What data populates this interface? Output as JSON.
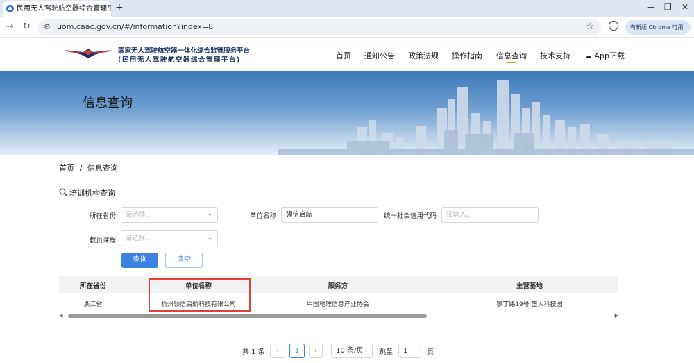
{
  "browser": {
    "tab_title": "民用无人驾驶航空器综合管理平",
    "tab_close": "✕",
    "new_tab": "+",
    "url": "uom.caac.gov.cn/#/information?index=8",
    "update_label": "有新版 Chrome 可用"
  },
  "header": {
    "brand_line1": "国家无人驾驶航空器一体化综合监管服务平台",
    "brand_line2": "(民用无人驾驶航空器综合管理平台)",
    "menu": [
      "首页",
      "通知公告",
      "政策法规",
      "操作指南",
      "信息查询",
      "技术支持",
      "App下载"
    ],
    "active_menu": "信息查询"
  },
  "banner": {
    "title": "信息查询"
  },
  "breadcrumb": {
    "home": "首页",
    "sep": "/",
    "current": "信息查询"
  },
  "section": {
    "title": "培训机构查询"
  },
  "form": {
    "province_label": "所在省份",
    "province_placeholder": "请选择..",
    "unit_label": "单位名称",
    "unit_value": "领信启航",
    "credit_label": "统一社会信用代码",
    "credit_placeholder": "请输入..",
    "course_label": "教员课程",
    "course_placeholder": "请选择..",
    "query_button": "查询",
    "clear_button": "清空"
  },
  "table": {
    "columns": [
      "所在省份",
      "单位名称",
      "服务方",
      "主营基地"
    ],
    "rows": [
      [
        "浙江省",
        "杭州领信启航科技有限公司",
        "中国地理信息产业协会",
        "寥丁路19号 盛大科技园"
      ]
    ]
  },
  "pagination": {
    "total": "共 1 条",
    "prev": "‹",
    "page": "1",
    "next": "›",
    "per_page": "10 条/页",
    "goto_label": "跳至",
    "goto_value": "1",
    "page_unit": "页"
  },
  "colors": {
    "accent": "#3b82e0",
    "highlight": "#e0403a",
    "brand": "#1b2f5e"
  }
}
